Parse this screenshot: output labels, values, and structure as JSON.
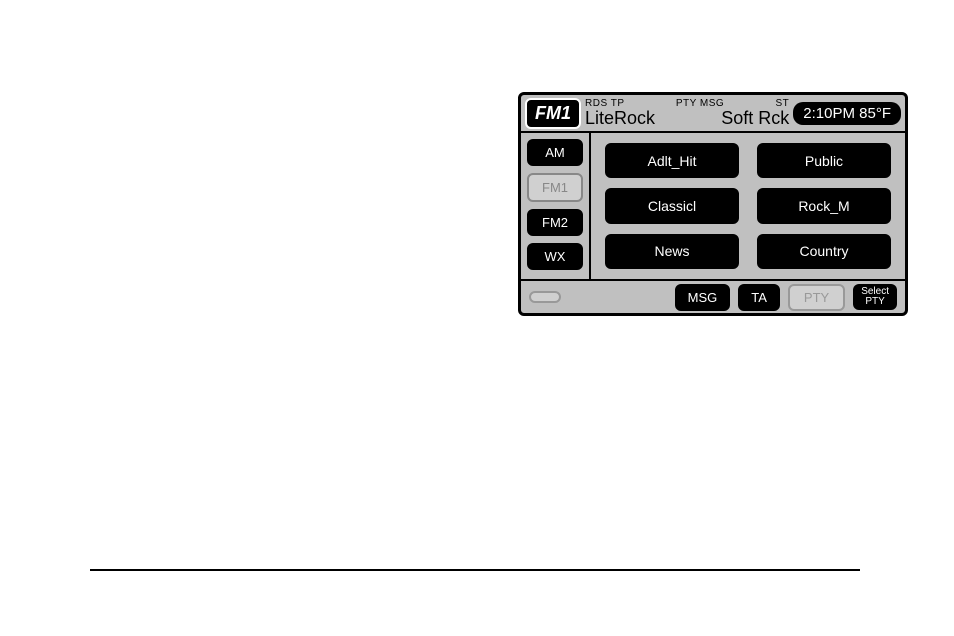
{
  "header": {
    "band": "FM1",
    "status1": "RDS TP",
    "status2": "PTY MSG",
    "status3": "ST",
    "station": "LiteRock",
    "genre": "Soft Rck",
    "clock_temp": "2:10PM 85°F"
  },
  "side": {
    "am": "AM",
    "fm1": "FM1",
    "fm2": "FM2",
    "wx": "WX"
  },
  "presets": {
    "p1": "Adlt_Hit",
    "p2": "Public",
    "p3": "Classicl",
    "p4": "Rock_M",
    "p5": "News",
    "p6": "Country"
  },
  "bottom": {
    "ghost1": "",
    "msg": "MSG",
    "ta": "TA",
    "pty": "PTY",
    "select_pty_line1": "Select",
    "select_pty_line2": "PTY"
  }
}
